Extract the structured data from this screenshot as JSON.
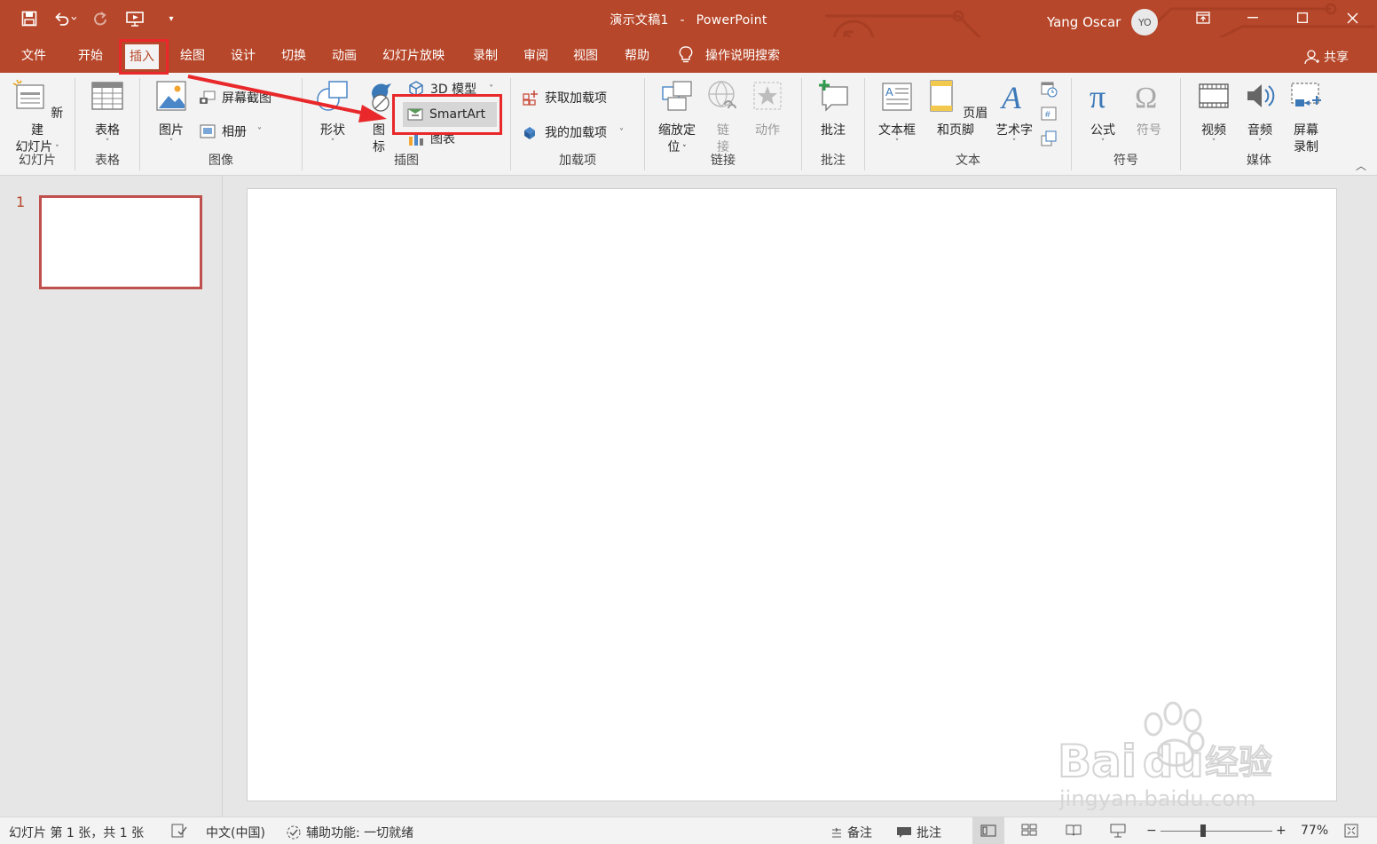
{
  "window": {
    "doc_name": "演示文稿1",
    "separator": "-",
    "app_name": "PowerPoint",
    "user_name": "Yang Oscar",
    "user_initials": "YO"
  },
  "qat": {
    "save": "save-icon",
    "undo": "undo-icon",
    "redo": "redo-icon",
    "present": "present-from-start-icon",
    "customize": "customize-icon"
  },
  "tabs": [
    "文件",
    "开始",
    "插入",
    "绘图",
    "设计",
    "切换",
    "动画",
    "幻灯片放映",
    "录制",
    "审阅",
    "视图",
    "帮助"
  ],
  "active_tab": "插入",
  "tell_me": "操作说明搜索",
  "share": "共享",
  "ribbon": {
    "slides": {
      "new_slide_line1": "新建",
      "new_slide_line2": "幻灯片",
      "group": "幻灯片"
    },
    "tables": {
      "table": "表格",
      "group": "表格"
    },
    "images": {
      "pictures": "图片",
      "screenshot": "屏幕截图",
      "album": "相册",
      "group": "图像"
    },
    "illustrations": {
      "shapes": "形状",
      "icons_line1": "图",
      "icons_line2": "标",
      "model3d": "3D 模型",
      "smartart": "SmartArt",
      "chart": "图表",
      "group": "插图"
    },
    "addins": {
      "get": "获取加载项",
      "mine": "我的加载项",
      "group": "加载项"
    },
    "links": {
      "zoom_line1": "缩放定",
      "zoom_line2": "位",
      "link_line1": "链",
      "link_line2": "接",
      "action": "动作",
      "group": "链接"
    },
    "comments": {
      "comment": "批注",
      "group": "批注"
    },
    "text": {
      "textbox": "文本框",
      "header_footer": "页眉和页脚",
      "wordart": "艺术字",
      "group": "文本"
    },
    "symbols": {
      "equation": "公式",
      "symbol": "符号",
      "group": "符号"
    },
    "media": {
      "video": "视频",
      "audio": "音频",
      "screen_rec_line1": "屏幕",
      "screen_rec_line2": "录制",
      "group": "媒体"
    }
  },
  "slides_panel": {
    "slide_number": "1"
  },
  "status": {
    "slide_info": "幻灯片 第 1 张，共 1 张",
    "language": "中文(中国)",
    "accessibility": "辅助功能: 一切就绪",
    "notes": "备注",
    "comments": "批注",
    "zoom_minus": "−",
    "zoom_plus": "+",
    "zoom": "77%"
  },
  "watermark": {
    "brand": "Bai经验",
    "url": "jingyan.baidu.com"
  },
  "colors": {
    "accent": "#b7472a",
    "highlight": "#e8282a"
  }
}
